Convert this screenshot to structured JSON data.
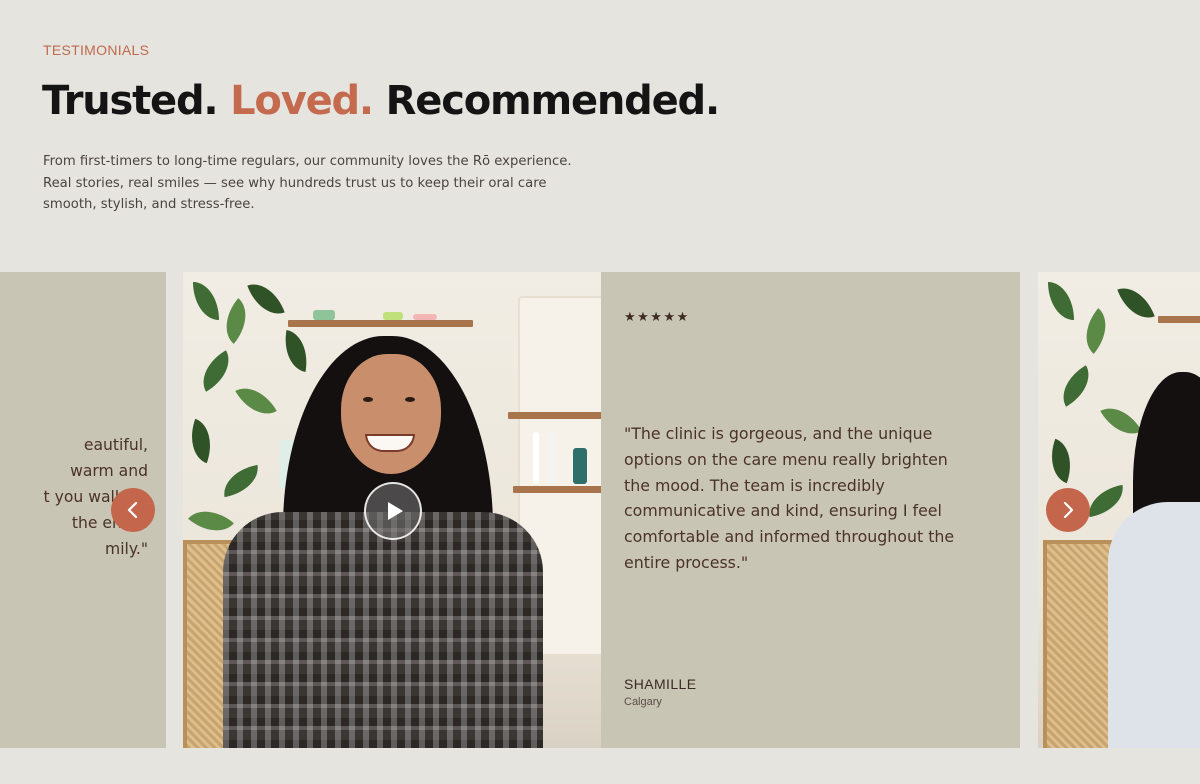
{
  "section": {
    "eyebrow": "TESTIMONIALS",
    "headline_part1": "Trusted.",
    "headline_part2": "Loved.",
    "headline_part3": "Recommended.",
    "intro_line1": "From first-timers to long-time regulars, our community loves the Rō experience.",
    "intro_line2": "Real stories, real smiles — see why hundreds trust us to keep their oral care",
    "intro_line3": "smooth, stylish, and stress-free."
  },
  "carousel": {
    "previous_card": {
      "quote_lines": [
        "eautiful,",
        "warm and",
        "t you walk in.",
        "the entire",
        "mily.\""
      ]
    },
    "active_review": {
      "rating": "★★★★★",
      "rating_value": 5,
      "quote": "\"The clinic is gorgeous, and the unique options on the care menu really brighten the mood. The team is incredibly communicative and kind, ensuring I feel comfortable and informed throughout the entire process.\"",
      "name": "SHAMILLE",
      "location": "Calgary"
    },
    "controls": {
      "prev_icon": "chevron-left-icon",
      "next_icon": "chevron-right-icon",
      "play_icon": "play-icon"
    }
  },
  "colors": {
    "background": "#e6e4df",
    "accent": "#c46a4e",
    "card": "#c9c5b5",
    "text_dark": "#141414"
  }
}
